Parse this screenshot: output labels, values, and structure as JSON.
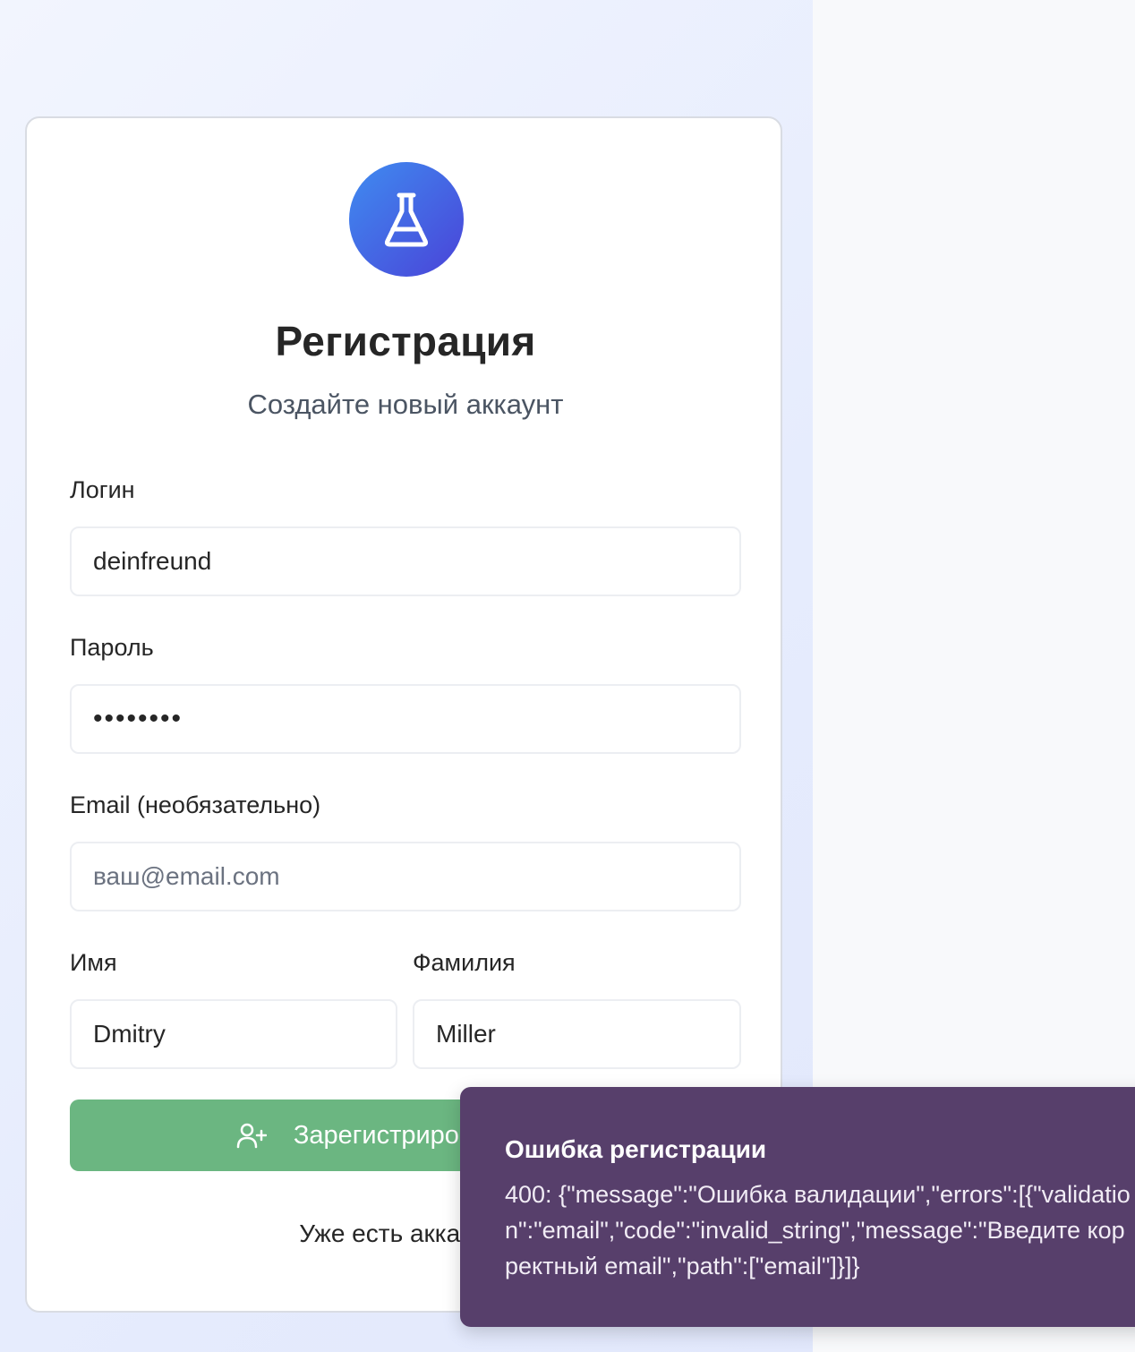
{
  "form": {
    "title": "Регистрация",
    "subtitle": "Создайте новый аккаунт",
    "login": {
      "label": "Логин",
      "value": "deinfreund"
    },
    "password": {
      "label": "Пароль",
      "masked_value": "••••••••"
    },
    "email": {
      "label": "Email (необязательно)",
      "value": "",
      "placeholder": "ваш@email.com"
    },
    "first_name": {
      "label": "Имя",
      "value": "Dmitry"
    },
    "last_name": {
      "label": "Фамилия",
      "value": "Miller"
    },
    "submit_label": "Зарегистрироваться",
    "login_prompt": "Уже есть аккаунт?",
    "logo_icon": "flask-icon",
    "submit_icon": "user-plus-icon"
  },
  "toast": {
    "title": "Ошибка регистрации",
    "message": "400: {\"message\":\"Ошибка валидации\",\"errors\":[{\"validation\":\"email\",\"code\":\"invalid_string\",\"message\":\"Введите корректный email\",\"path\":[\"email\"]}]}"
  },
  "colors": {
    "accent_gradient_start": "#3f8cf0",
    "accent_gradient_end": "#4a43d8",
    "submit_button": "#6bb681",
    "toast_bg": "#573f6b"
  }
}
